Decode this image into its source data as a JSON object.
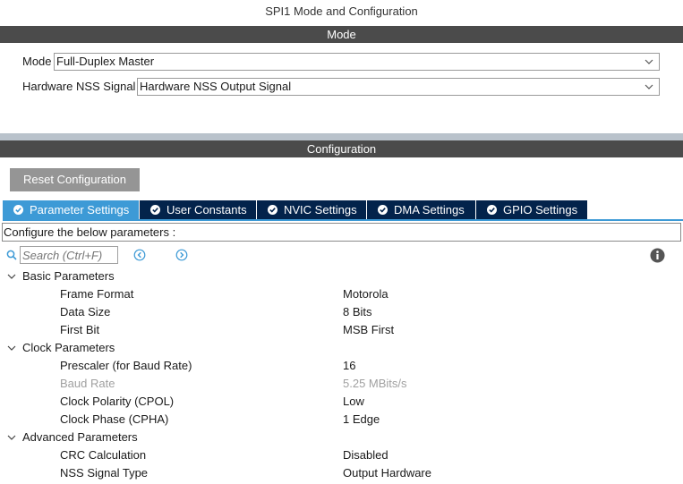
{
  "window_title": "SPI1 Mode and Configuration",
  "mode_section": {
    "header": "Mode",
    "mode_label": "Mode",
    "mode_value": "Full-Duplex Master",
    "nss_label": "Hardware NSS Signal",
    "nss_value": "Hardware NSS Output Signal"
  },
  "config_section": {
    "header": "Configuration",
    "reset_button": "Reset Configuration",
    "tabs": [
      {
        "label": "Parameter Settings",
        "active": true
      },
      {
        "label": "User Constants",
        "active": false
      },
      {
        "label": "NVIC Settings",
        "active": false
      },
      {
        "label": "DMA Settings",
        "active": false
      },
      {
        "label": "GPIO Settings",
        "active": false
      }
    ],
    "configure_text": "Configure the below parameters :",
    "search_placeholder": "Search (Ctrl+F)"
  },
  "parameters": [
    {
      "group": "Basic Parameters",
      "items": [
        {
          "name": "Frame Format",
          "value": "Motorola"
        },
        {
          "name": "Data Size",
          "value": "8 Bits"
        },
        {
          "name": "First Bit",
          "value": "MSB First"
        }
      ]
    },
    {
      "group": "Clock Parameters",
      "items": [
        {
          "name": "Prescaler (for Baud Rate)",
          "value": "16"
        },
        {
          "name": "Baud Rate",
          "value": "5.25 MBits/s",
          "disabled": true
        },
        {
          "name": "Clock Polarity (CPOL)",
          "value": "Low"
        },
        {
          "name": "Clock Phase (CPHA)",
          "value": "1 Edge"
        }
      ]
    },
    {
      "group": "Advanced Parameters",
      "items": [
        {
          "name": "CRC Calculation",
          "value": "Disabled"
        },
        {
          "name": "NSS Signal Type",
          "value": "Output Hardware"
        }
      ]
    }
  ],
  "colors": {
    "section_bar": "#4b4b4b",
    "tab_active": "#3d9ad6",
    "tab_inactive": "#03234b",
    "reset_button": "#959595",
    "nav_arrow": "#3d9ad6"
  }
}
